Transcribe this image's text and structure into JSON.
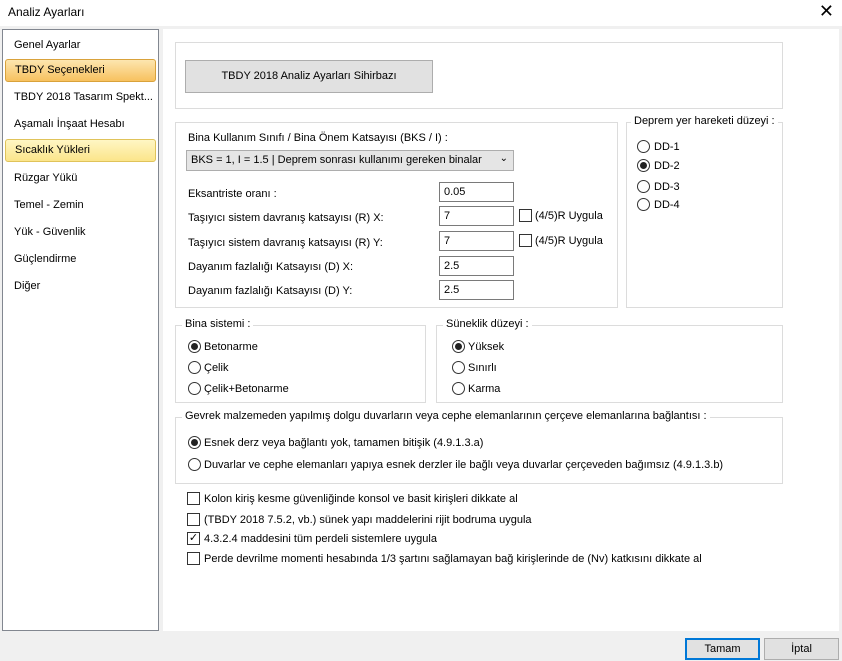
{
  "window": {
    "title": "Analiz Ayarları",
    "close_glyph": "✕"
  },
  "sidebar": {
    "items": [
      {
        "label": "Genel Ayarlar"
      },
      {
        "label": "TBDY Seçenekleri"
      },
      {
        "label": "TBDY 2018 Tasarım Spekt..."
      },
      {
        "label": "Aşamalı İnşaat Hesabı"
      },
      {
        "label": "Sıcaklık Yükleri"
      },
      {
        "label": "Rüzgar Yükü"
      },
      {
        "label": "Temel - Zemin"
      },
      {
        "label": "Yük - Güvenlik"
      },
      {
        "label": "Güçlendirme"
      },
      {
        "label": "Diğer"
      }
    ],
    "selected": "TBDY Seçenekleri",
    "highlighted": "Sıcaklık Yükleri"
  },
  "wizard_button": "TBDY 2018 Analiz Ayarları Sihirbazı",
  "params": {
    "bks_label": "Bina Kullanım Sınıfı / Bina Önem Katsayısı (BKS / I) :",
    "bks_value": "BKS = 1, I = 1.5 | Deprem sonrası kullanımı gereken binalar",
    "eksantrik_label": "Eksantriste oranı :",
    "eksantrik_value": "0.05",
    "rx_label": "Taşıyıcı sistem davranış katsayısı (R) X:",
    "rx_value": "7",
    "rx_check": "(4/5)R Uygula",
    "ry_label": "Taşıyıcı sistem davranış katsayısı (R) Y:",
    "ry_value": "7",
    "ry_check": "(4/5)R Uygula",
    "dx_label": "Dayanım fazlalığı Katsayısı (D) X:",
    "dx_value": "2.5",
    "dy_label": "Dayanım fazlalığı Katsayısı (D) Y:",
    "dy_value": "2.5"
  },
  "deprem": {
    "legend": "Deprem yer hareketi düzeyi :",
    "options": [
      "DD-1",
      "DD-2",
      "DD-3",
      "DD-4"
    ],
    "selected": "DD-2"
  },
  "bina_sistemi": {
    "legend": "Bina sistemi :",
    "options": [
      "Betonarme",
      "Çelik",
      "Çelik+Betonarme"
    ],
    "selected": "Betonarme"
  },
  "suneklik": {
    "legend": "Süneklik düzeyi :",
    "options": [
      "Yüksek",
      "Sınırlı",
      "Karma"
    ],
    "selected": "Yüksek"
  },
  "dolgu": {
    "legend": "Gevrek malzemeden yapılmış dolgu duvarların veya cephe elemanlarının çerçeve elemanlarına bağlantısı :",
    "options": [
      "Esnek derz veya bağlantı yok, tamamen bitişik (4.9.1.3.a)",
      "Duvarlar ve cephe elemanları yapıya esnek derzler ile bağlı veya duvarlar çerçeveden bağımsız (4.9.1.3.b)"
    ],
    "selected": 0
  },
  "checks": [
    {
      "label": "Kolon kiriş kesme güvenliğinde konsol ve basit kirişleri dikkate al",
      "checked": false
    },
    {
      "label": "(TBDY 2018 7.5.2, vb.) sünek yapı maddelerini rijit bodruma uygula",
      "checked": false
    },
    {
      "label": "4.3.2.4 maddesini tüm perdeli sistemlere uygula",
      "checked": true
    },
    {
      "label": "Perde devrilme momenti hesabında 1/3 şartını sağlamayan bağ kirişlerinde de (Nv) katkısını dikkate al",
      "checked": false
    }
  ],
  "check_glyph": "✓",
  "buttons": {
    "ok": "Tamam",
    "cancel": "İptal"
  }
}
